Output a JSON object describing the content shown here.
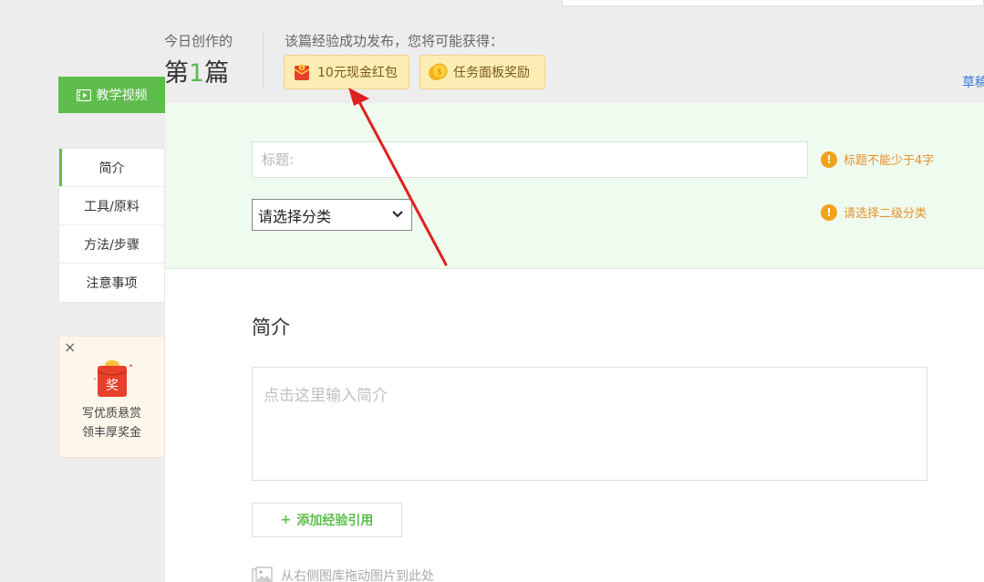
{
  "header": {
    "today_label": "今日创作的",
    "today_count_prefix": "第",
    "today_count_num": "1",
    "today_count_suffix": "篇",
    "reward_title": "该篇经验成功发布，您将可能获得：",
    "reward_badges": [
      {
        "label": "10元现金红包",
        "icon": "red-envelope-icon"
      },
      {
        "label": "任务面板奖励",
        "icon": "gold-coin-icon"
      }
    ],
    "draft_link": "草稿"
  },
  "sidebar": {
    "video_button": "教学视频",
    "nav_items": [
      {
        "label": "简介",
        "active": true
      },
      {
        "label": "工具/原料",
        "active": false
      },
      {
        "label": "方法/步骤",
        "active": false
      },
      {
        "label": "注意事项",
        "active": false
      }
    ],
    "promo": {
      "close": "×",
      "line1": "写优质悬赏",
      "line2": "领丰厚奖金",
      "icon": "reward-envelope-icon",
      "icon_char": "奖"
    }
  },
  "form": {
    "title_placeholder": "标题:",
    "category_value": "请选择分类",
    "title_warning": "标题不能少于4字",
    "category_warning": "请选择二级分类",
    "warning_mark": "!"
  },
  "intro": {
    "section_title": "简介",
    "placeholder": "点击这里输入简介",
    "add_ref_plus": "+",
    "add_ref_label": "添加经验引用",
    "drag_hint": "从右侧图库拖动图片到此处"
  },
  "colors": {
    "accent_green": "#5ebd4c",
    "warning_orange": "#f2a21d",
    "annotation_red": "#e02020"
  }
}
